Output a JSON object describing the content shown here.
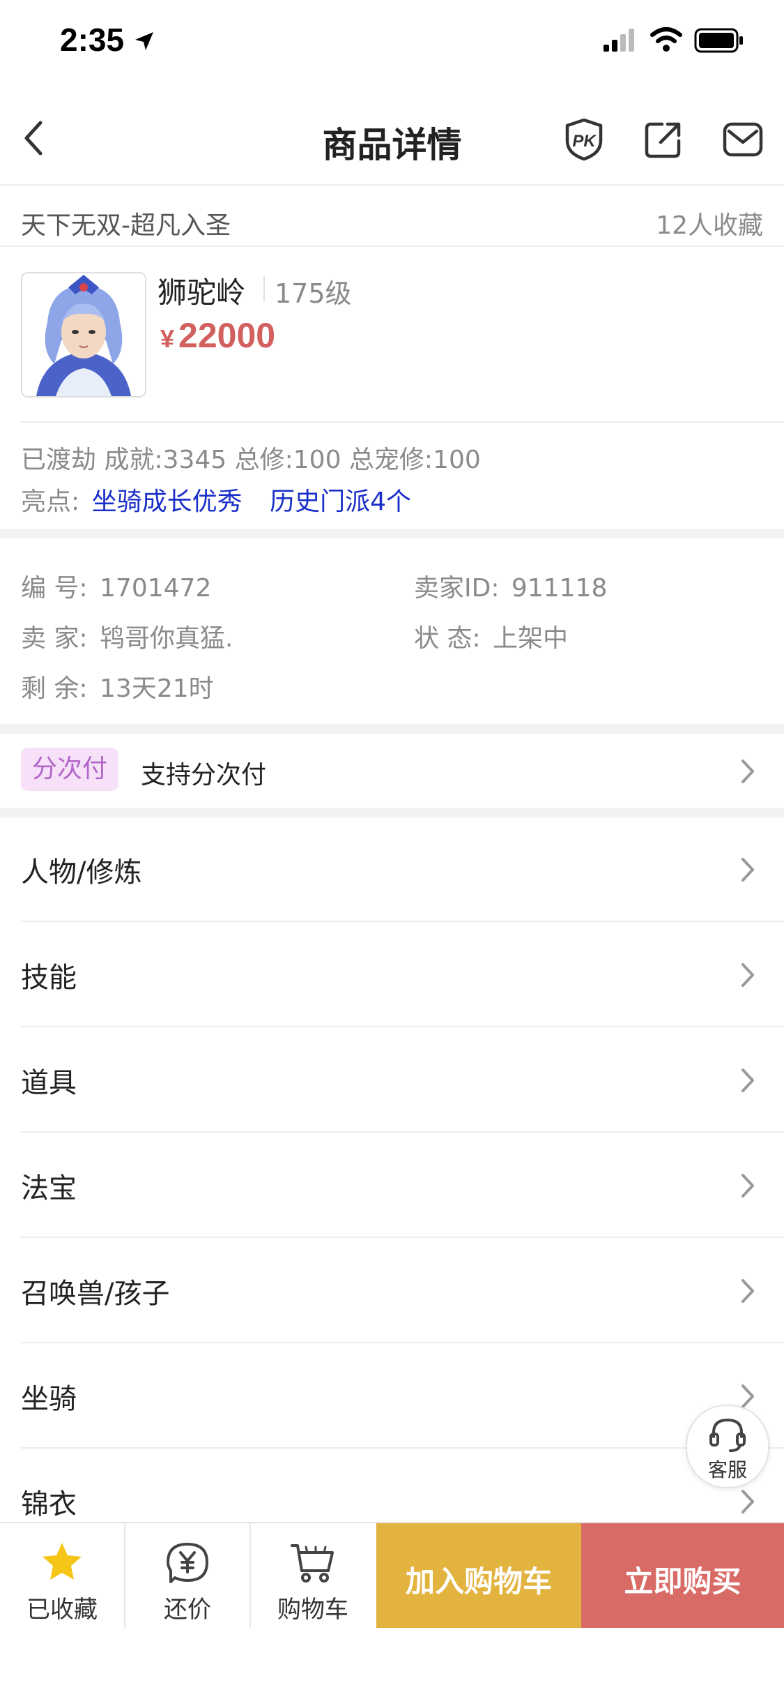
{
  "status_bar": {
    "time": "2:35"
  },
  "nav": {
    "title": "商品详情",
    "pk_label": "PK"
  },
  "server": {
    "name": "天下无双-超凡入圣",
    "favorites": "12人收藏"
  },
  "character": {
    "school": "狮驼岭",
    "level": "175级",
    "currency": "¥",
    "price": "22000"
  },
  "summary": {
    "stats": "已渡劫 成就:3345 总修:100 总宠修:100",
    "highlights_label": "亮点:",
    "highlights": [
      "坐骑成长优秀",
      "历史门派4个"
    ]
  },
  "info": {
    "serial_label": "编 号:",
    "serial": "1701472",
    "seller_id_label": "卖家ID:",
    "seller_id": "911118",
    "seller_label": "卖 家:",
    "seller": "鸨哥你真猛.",
    "state_label": "状 态:",
    "state": "上架中",
    "remaining_label": "剩 余:",
    "remaining": "13天21时"
  },
  "installment": {
    "badge": "分次付",
    "text": "支持分次付"
  },
  "menu": [
    {
      "label": "人物/修炼"
    },
    {
      "label": "技能"
    },
    {
      "label": "道具"
    },
    {
      "label": "法宝"
    },
    {
      "label": "召唤兽/孩子"
    },
    {
      "label": "坐骑"
    },
    {
      "label": "锦衣"
    }
  ],
  "support": {
    "label": "客服"
  },
  "tabbar": {
    "favorited": "已收藏",
    "bargain": "还价",
    "cart": "购物车",
    "add_to_cart": "加入购物车",
    "buy_now": "立即购买"
  },
  "colors": {
    "price": "#d2605f",
    "link": "#1a2fc9",
    "badge_bg": "#f6e1f8",
    "badge_text": "#b266c9",
    "add_to_cart": "#e3b340",
    "buy_now": "#d96b66",
    "star": "#f5c518"
  }
}
